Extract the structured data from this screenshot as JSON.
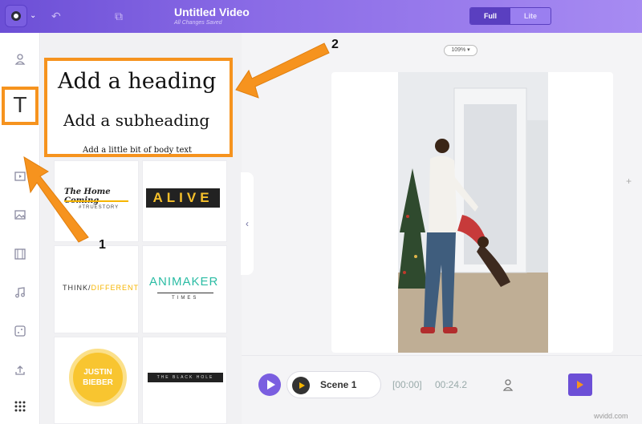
{
  "header": {
    "title": "Untitled Video",
    "save_status": "All Changes Saved",
    "mode_full": "Full",
    "mode_lite": "Lite",
    "logo_caret": "⌄",
    "undo_icon": "↶",
    "copy_icon": "⧉"
  },
  "rail": {
    "icons": [
      "person-icon",
      "coffee-icon",
      "text-icon",
      "video-icon",
      "image-icon",
      "film-icon",
      "music-icon",
      "dice-icon",
      "upload-icon",
      "grid-icon"
    ],
    "text_tool_glyph": "T"
  },
  "text_panel": {
    "heading": "Add a heading",
    "subheading": "Add a subheading",
    "body": "Add a little bit of body text",
    "templates": {
      "homecoming_title": "The Home Coming",
      "homecoming_tag": "#TRUESTORY",
      "alive": "ALIVE",
      "think": "THINK/",
      "different": "DIFFERENT",
      "animaker": "ANIMAKER",
      "times": "TIMES",
      "justin": "JUSTIN",
      "bieber": "BIEBER",
      "black_hole": "THE BLACK HOLE"
    },
    "collapse_glyph": "‹"
  },
  "canvas": {
    "zoom": "109% ▾",
    "add_glyph": "+"
  },
  "timeline": {
    "scene_label": "Scene 1",
    "start_time": "[00:00]",
    "duration": "00:24.2"
  },
  "annotations": {
    "badge_1": "1",
    "badge_2": "2",
    "accent_color": "#f6931e"
  },
  "watermark": "wvidd.com"
}
